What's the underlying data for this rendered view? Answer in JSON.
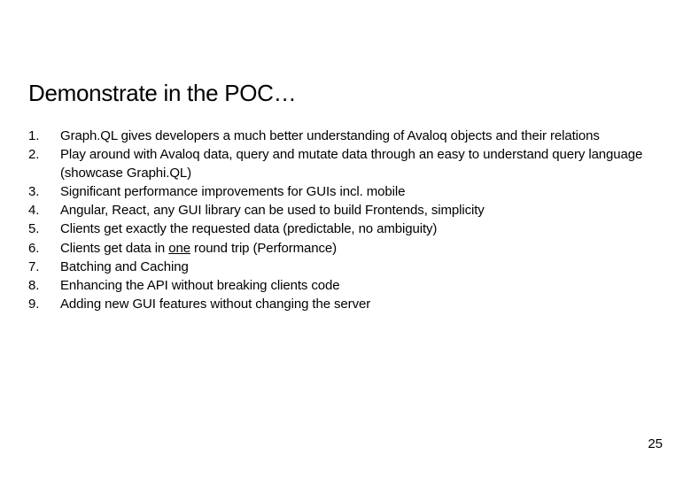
{
  "title": "Demonstrate in the POC…",
  "items": [
    "Graph.QL gives developers a much better understanding of Avaloq objects and their relations",
    "Play around with Avaloq data, query and mutate data through an easy to understand query language (showcase Graphi.QL)",
    "Significant performance improvements for GUIs incl. mobile",
    "Angular, React, any GUI library can be used to build Frontends, simplicity",
    "Clients get exactly the requested data (predictable, no ambiguity)",
    "",
    "Batching and Caching",
    "Enhancing the API without breaking clients code",
    "Adding new GUI features without changing the server"
  ],
  "item6_prefix": "Clients get data in ",
  "item6_underline": "one",
  "item6_suffix": " round trip (Performance)",
  "page_number": "25"
}
